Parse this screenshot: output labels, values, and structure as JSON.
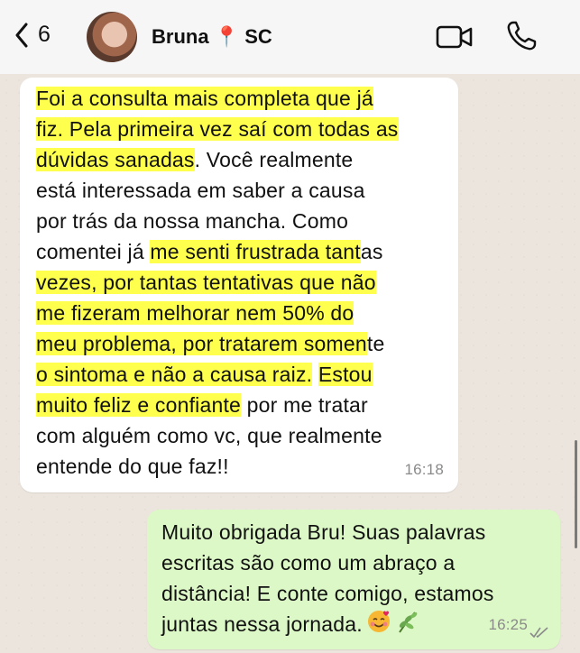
{
  "header": {
    "back_count": "6",
    "contact_name": "Bruna",
    "contact_location": "SC"
  },
  "messages": [
    {
      "lines": [
        [
          {
            "t": "Foi a consulta mais completa que já",
            "h": true
          }
        ],
        [
          {
            "t": "fiz. Pela primeira vez saí com todas as",
            "h": true
          }
        ],
        [
          {
            "t": "dúvidas sanadas",
            "h": true
          },
          {
            "t": ". Você realmente",
            "h": false
          }
        ],
        [
          {
            "t": "está interessada em saber a causa",
            "h": false
          }
        ],
        [
          {
            "t": "por trás da nossa mancha. Como",
            "h": false
          }
        ],
        [
          {
            "t": "comentei já ",
            "h": false
          },
          {
            "t": "me senti frustrada tant",
            "h": true
          },
          {
            "t": "as",
            "h": false
          }
        ],
        [
          {
            "t": "vezes, por tantas tentativas que não",
            "h": true
          }
        ],
        [
          {
            "t": "me fizeram melhorar nem 50% do",
            "h": true
          }
        ],
        [
          {
            "t": "meu problema, por tratarem somen",
            "h": true
          },
          {
            "t": "te",
            "h": false
          }
        ],
        [
          {
            "t": "o sintoma e não a causa raiz.",
            "h": true
          },
          {
            "t": " ",
            "h": false
          },
          {
            "t": "Estou",
            "h": true
          }
        ],
        [
          {
            "t": "muito feliz e confiante",
            "h": true
          },
          {
            "t": " por me tratar",
            "h": false
          }
        ],
        [
          {
            "t": "com alguém como vc, que realmente",
            "h": false
          }
        ],
        [
          {
            "t": "entende do que faz!!",
            "h": false
          }
        ]
      ],
      "time": "16:18"
    },
    {
      "lines": [
        [
          {
            "t": "Muito obrigada Bru! Suas palavras",
            "h": false
          }
        ],
        [
          {
            "t": "escritas são como um abraço a",
            "h": false
          }
        ],
        [
          {
            "t": "distância! E conte comigo, estamos",
            "h": false
          }
        ],
        [
          {
            "t": "juntas nessa jornada.",
            "h": false
          }
        ]
      ],
      "time": "16:25"
    }
  ],
  "icons": {
    "back": "chevron-left-icon",
    "pin": "pin-icon",
    "video": "video-camera-icon",
    "phone": "phone-icon",
    "emoji_1": "smiling-face-with-hearts-icon",
    "emoji_2": "herb-icon",
    "read": "double-check-icon"
  },
  "colors": {
    "incoming_bubble": "#ffffff",
    "outgoing_bubble": "#dcf8c6",
    "highlight": "#ffff4d",
    "chat_background": "#ece5dd",
    "pin": "#d8332a"
  }
}
